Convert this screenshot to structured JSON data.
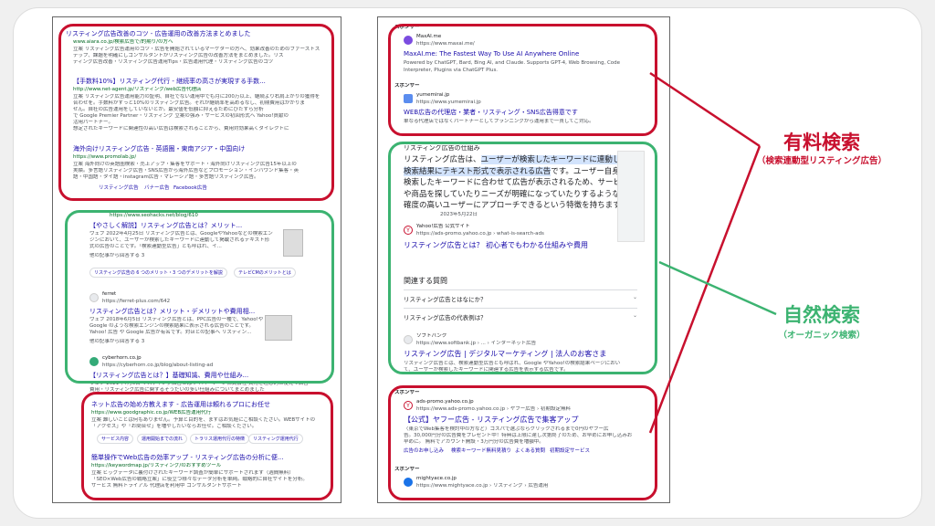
{
  "annotations": {
    "paid_title": "有料検索",
    "paid_sub": "（検索連動型リスティング広告）",
    "organic_title": "自然検索",
    "organic_sub": "（オーガニック検索）",
    "colors": {
      "paid": "#c8102e",
      "organic": "#3cb371",
      "link": "#1a0dab",
      "url": "#006621"
    }
  },
  "left": {
    "ad1": {
      "title": "リスティング広告改善のコツ - 広告運用の改善方法まとめました",
      "url": "www.aiara.co.jp/検索広告で/的期り/の方へ",
      "desc1": "立案 リスティング広告運用のコツ・広告を開始されているマーケターの方へ、効果改善のためのファーストス",
      "desc2": "テップ、課題を明確にしコンサルタントがリスティング広告の改善方法をまとめました。リス",
      "desc3": "ティング広告改善・リスティング広告運用Tips・広告運用代理・リスティング広告のコツ"
    },
    "ad2": {
      "title": "【手数料10%】リスティング代行 - 継続率の高さが実現する手数...",
      "url": "http://www.net-agent.jp/リスティング/web広告代理店",
      "desc1": "立案 リスティング広告運用能力の証明、自社でない運用中でも月に200万以上、継続より右肩上がりの獲得を",
      "desc2": "合わせを。手数料がずっと10%のリスティング広告。それが継続率を高めるなし、初期費用はかかりま",
      "desc3": "せん。自社の広告運用をしていないとか。最安値を低額に抑えるためにひたすら分析",
      "desc4": "で Google Premier Partner・リスティング 立案の強み・サービスの初回形式へ Yahoo!貢献の",
      "desc5": "活用パートナー。",
      "desc6": "想定されたキーワードに関連性の高い広告は検索されることから、費用対効果高くダイレクトに"
    },
    "ad3": {
      "title": "海外向けリスティング広告 - 英語圏・東南アジア・中国向け",
      "url": "https://www.promolab.jp/",
      "desc1": "立案 海外向けの英語圏検索・売上アップ・集客をサポート・海外向けリスティング広告15年以上の",
      "desc2": "実績。多言語リスティング広告・SNS広告から海外広告などプロモーション・インバウンド集客・英",
      "desc3": "語・中国語・タイ語・instagram広告・マレーシア語・多言語リスティング広告。",
      "links": [
        "リスティング広告",
        "バナー広告",
        "Facebook広告"
      ]
    },
    "org1": {
      "site": "https://www.seohacks.net/blog/610",
      "title": "【やさしく解説】リスティング広告とは？メリット...",
      "desc1": "ウェブ 2022年4月25日 リスティング広告とは、GoogleやYahooなどの検索エン",
      "desc2": "ジンにおいて、ユーザーが検索したキーワードに連動して掲載されるテキスト形",
      "desc3": "式の広告のことです。「検索連動型広告」とも呼ばれ、イ...",
      "more": "他の記事から回答する 3",
      "pills": [
        "リスティング広告の 6 つのメリット・3 つのデメリットを解説",
        "テレビCMのメリットとは"
      ]
    },
    "org2": {
      "site": "ferret",
      "url": "https://ferret-plus.com/642",
      "title": "リスティング広告とは？メリット・デメリットや費用相...",
      "desc1": "ウェブ 2018年6月5日 リスティング広告とは、PPC広告の一種で、Yahoo!や",
      "desc2": "Google のような検索エンジンの検索結果に表示される広告のことです。",
      "desc3": "Yahoo! 広告 や Google 広告が有名です。対ほとの記事へ リスティン...",
      "more": "他の記事から回答する 3"
    },
    "org3": {
      "site": "cyberhorn.co.jp",
      "url": "https://cyberhorn.co.jp/blog/about-listing-ad",
      "title": "【リスティング広告とは？】基礎知識、費用や仕組み...",
      "desc1": "ウェブ 2021年7月6日 リスティング広告とはサイバーホーン株式会社 費用を理想的に使えて広告",
      "desc2": "費用・リスティング広告に関するそうだいの多い仕組みについてまとめました"
    },
    "ad4": {
      "title": "ネット広告の始め方教えます - 広告運用は頼れるプロにお任せ",
      "url": "https://www.goodgraphic.co.jp/WEB広告運用代行",
      "desc1": "立案 難しいことは何もありません。予算と目的を、まずはお気軽にご相談ください。WEBサイトの",
      "desc2": "「アクセス」や「お問合せ」を増やしたいならお任せ。ご相談ください。",
      "links": [
        "サービス内容",
        "運用開始までの流れ",
        "トラリス運用代行の特徴",
        "リスティング運用代行"
      ]
    },
    "ad5": {
      "title": "簡単操作でWeb広告の効率アップ - リスティング広告の分析に便...",
      "url": "https://keywordmap.jp/リスティング/のおすすめツール",
      "desc1": "立案 ビッグデータに裏付けされたキーワード調査が簡単にサポートされます（週間無料）",
      "desc2": "「SEO×Web広告の戦略立案」に役立つ様々なデータ分析を単純。戦略的に自社サイトを分析。",
      "desc3": "サービス 無料トライアル 代理店を利用中 コンサルタントサポート"
    }
  },
  "right": {
    "sponsor": "スポンサー",
    "ad1": {
      "site": "MaxAI.me",
      "url": "https://www.maxai.me/",
      "title": "MaxAI.me: The Fastest Way To Use AI Anywhere Online",
      "desc1": "Powered by ChatGPT, Bard, Bing AI, and Claude. Supports GPT-4, Web Browsing, Code",
      "desc2": "Interpreter, Plugins via ChatGPT Plus."
    },
    "ad2": {
      "site": "yumemirai.jp",
      "url": "https://www.yumemirai.jp",
      "title": "WEB広告の代理店・業者・リスティング・SNS広告得意です",
      "desc1": "単なる代理店ではなくパートナーとしてプランニングから運用まで一貫してご対応。"
    },
    "featured": {
      "heading": "リスティング広告の仕組み",
      "text_pre": "リスティング広告は、",
      "text_hl": "ユーザーが検索したキーワードに連動して検索結果にテキスト形式で表示される広告",
      "text_post": "です。ユーザー自身が検索したキーワードに合わせて広告が表示されるため、サービスや商品を探していたりニーズが明確になっていたりするような、確度の高いユーザーにアプローチできるという特徴を持ちます。",
      "date": "2023年5月22日",
      "src_name": "Yahoo!広告 公式サイト",
      "src_url": "https://ads-promo.yahoo.co.jp › what-is-search-ads",
      "src_title": "リスティング広告とは？ 初心者でもわかる仕組みや費用"
    },
    "paa": {
      "heading": "関連する質問",
      "q1": "リスティング広告とはなにか？",
      "q2": "リスティング広告の代表例は？",
      "chev": "⌄"
    },
    "org": {
      "site": "ソフトバンク",
      "url": "https://www.softbank.jp › ... › インターネット広告",
      "title": "リスティング広告 | デジタルマーケティング | 法人のお客さま",
      "desc1": "リスティング広告とは、検索連動型広告とも呼ばれ、Google やYahoo!の検索結果ページにおい",
      "desc2": "て、ユーザーが検索したキーワードに関連する広告を表示する広告です。"
    },
    "ad3": {
      "site": "ads-promo.yahoo.co.jp",
      "url": "https://www.ads-promo.yahoo.co.jp › ヤフー広告 › 初期設定無料",
      "title": "【公式】ヤフー広告 - リスティング広告で集客アップ",
      "desc1": "〈東京でWeb集客を検討中の方など〉コスパで選ぶならクリックされるまで0円のヤフー広",
      "desc2": "告。30,000円分の広告費をプレゼント中！特典は上限に達し次第終了のため、お早めにお申し込みお",
      "desc3": "早めに。 無料でアカウント開設・3万円分の広告費を増額中。",
      "links": [
        "広告のお申し込み",
        "検索キーワード無料見積り",
        "よくある質問",
        "初期設定サービス"
      ]
    },
    "ad4": {
      "site": "mightyace.co.jp",
      "url": "https://www.mightyace.co.jp › リスティング › 広告運用"
    }
  }
}
